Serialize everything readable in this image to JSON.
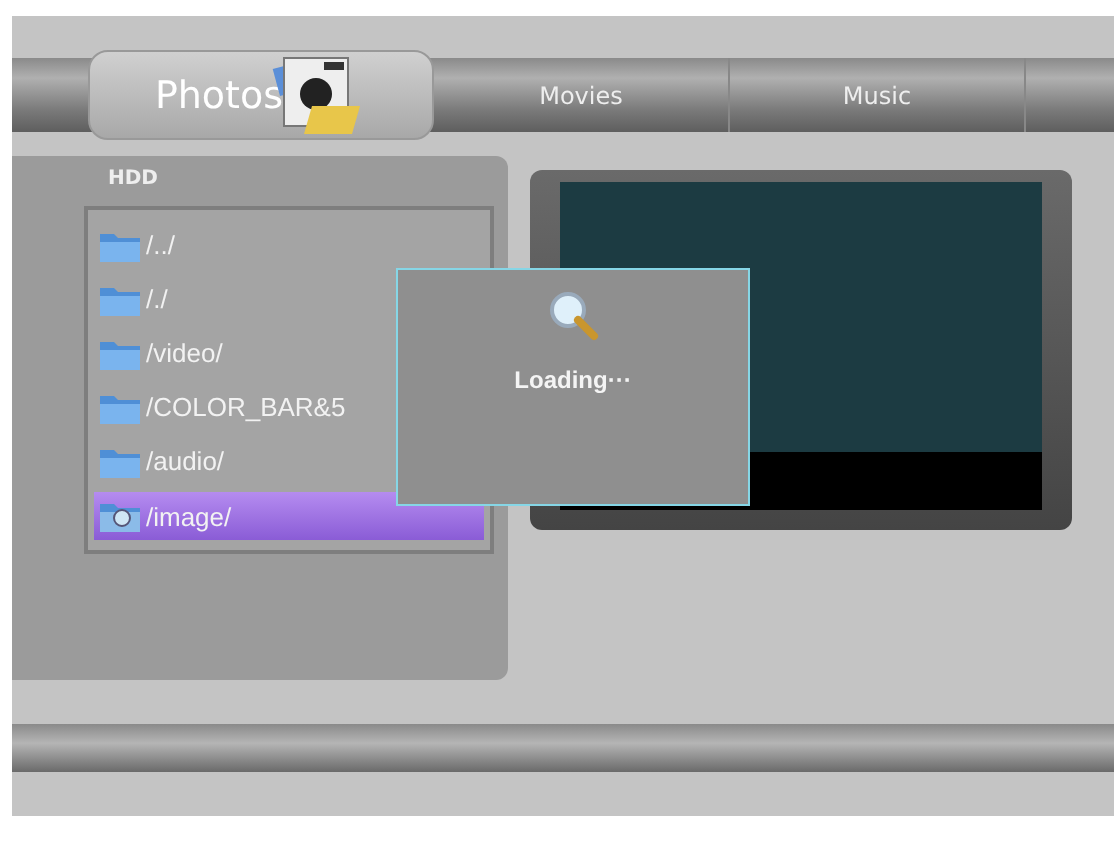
{
  "tabs": [
    {
      "label": "Photos",
      "selected": true
    },
    {
      "label": "Movies",
      "selected": false
    },
    {
      "label": "Music",
      "selected": false
    }
  ],
  "browser": {
    "title": "HDD",
    "items": [
      {
        "name": "/../",
        "kind": "folder",
        "selected": false
      },
      {
        "name": "/./",
        "kind": "folder",
        "selected": false
      },
      {
        "name": "/video/",
        "kind": "folder",
        "selected": false
      },
      {
        "name": "/COLOR_BAR&5",
        "kind": "folder",
        "selected": false
      },
      {
        "name": "/audio/",
        "kind": "folder",
        "selected": false
      },
      {
        "name": "/image/",
        "kind": "image-folder",
        "selected": true
      }
    ]
  },
  "dialog": {
    "message": "Loading···"
  }
}
